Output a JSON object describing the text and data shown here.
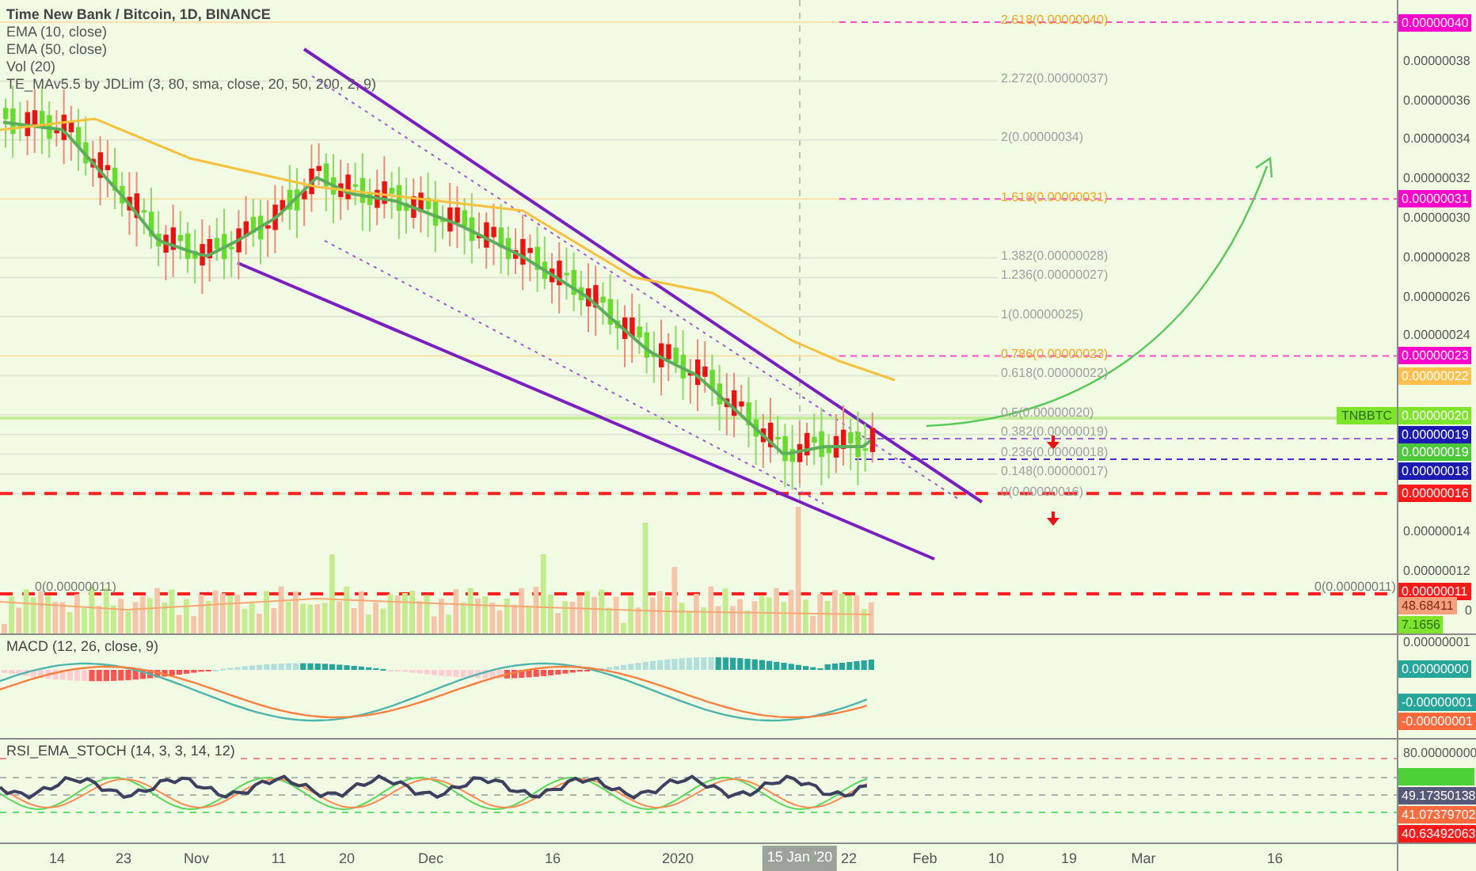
{
  "legend": {
    "title": "Time New Bank / Bitcoin, 1D, BINANCE",
    "studies": [
      "EMA (10, close)",
      "EMA (50, close)",
      "Vol (20)",
      "TE_MAv5.5 by JDLim (3, 80, sma, close, 20, 50, 200, 2, 9)"
    ]
  },
  "main_axis": {
    "ticks": [
      "0.00000038",
      "0.00000036",
      "0.00000034",
      "0.00000032",
      "0.00000030",
      "0.00000028",
      "0.00000026",
      "0.00000024",
      "0.00000014",
      "0.00000012"
    ],
    "tags": [
      {
        "text": "0.00000040",
        "color": "#ff00cc"
      },
      {
        "text": "0.00000031",
        "color": "#ff00cc"
      },
      {
        "text": "0.00000023",
        "color": "#ff00cc"
      },
      {
        "text": "0.00000022",
        "color": "#ffc04d"
      },
      {
        "text": "0.00000020",
        "color": "#7ee52a",
        "symbol": "TNBBTC"
      },
      {
        "text": "0.00000019",
        "color": "#1b1bb3"
      },
      {
        "text": "0.00000019",
        "color": "#4cc93a"
      },
      {
        "text": "0.00000018",
        "color": "#1b1bb3"
      },
      {
        "text": "0.00000016",
        "color": "#ff1a1a"
      },
      {
        "text": "0.00000011",
        "color": "#ff1a1a"
      }
    ]
  },
  "fib_levels": [
    {
      "label": "2.618(0.00000040)",
      "color": "#f5a623"
    },
    {
      "label": "2.272(0.00000037)",
      "color": "#a0a0a0"
    },
    {
      "label": "2(0.00000034)",
      "color": "#a0a0a0"
    },
    {
      "label": "1.618(0.00000031)",
      "color": "#f5a623"
    },
    {
      "label": "1.382(0.00000028)",
      "color": "#a0a0a0"
    },
    {
      "label": "1.236(0.00000027)",
      "color": "#a0a0a0"
    },
    {
      "label": "1(0.00000025)",
      "color": "#a0a0a0"
    },
    {
      "label": "0.786(0.00000023)",
      "color": "#f5a623"
    },
    {
      "label": "0.618(0.00000022)",
      "color": "#a0a0a0"
    },
    {
      "label": "0.5(0.00000020)",
      "color": "#a0a0a0"
    },
    {
      "label": "0.382(0.00000019)",
      "color": "#a0a0a0"
    },
    {
      "label": "0.236(0.00000018)",
      "color": "#a0a0a0"
    },
    {
      "label": "0.148(0.00000017)",
      "color": "#a0a0a0"
    },
    {
      "label": "0(0.00000016)",
      "color": "#a0a0a0"
    }
  ],
  "level_labels": [
    "0(0.00000011)",
    "0(0.00000011)"
  ],
  "volume_axis": {
    "tags": [
      {
        "text": "48.68411",
        "color": "#f6a07e"
      },
      {
        "text": "7.1656",
        "color": "#7ee52a"
      }
    ],
    "tick": "0"
  },
  "macd": {
    "title": "MACD (12, 26, close, 9)",
    "ticks": [
      "0.00000001"
    ],
    "tags": [
      {
        "text": "0.00000000",
        "color": "#26a69a"
      },
      {
        "text": "-0.00000001",
        "color": "#26a69a"
      },
      {
        "text": "-0.00000001",
        "color": "#ff6a3d"
      }
    ]
  },
  "rsi": {
    "title": "RSI_EMA_STOCH (14, 3, 3, 14, 12)",
    "ticks": [
      "80.00000000"
    ],
    "tags": [
      {
        "color": "#4cd137"
      },
      {
        "text": "49.17350138",
        "color": "#545a78"
      },
      {
        "text": "41.07379702",
        "color": "#ff6a3d"
      },
      {
        "text": "40.63492063",
        "color": "#ff1a1a"
      }
    ]
  },
  "time_axis": {
    "labels": [
      "14",
      "23",
      "Nov",
      "11",
      "20",
      "Dec",
      "16",
      "2020",
      "22",
      "Feb",
      "10",
      "19",
      "Mar",
      "16"
    ],
    "cursor_label": "15 Jan '20"
  }
}
